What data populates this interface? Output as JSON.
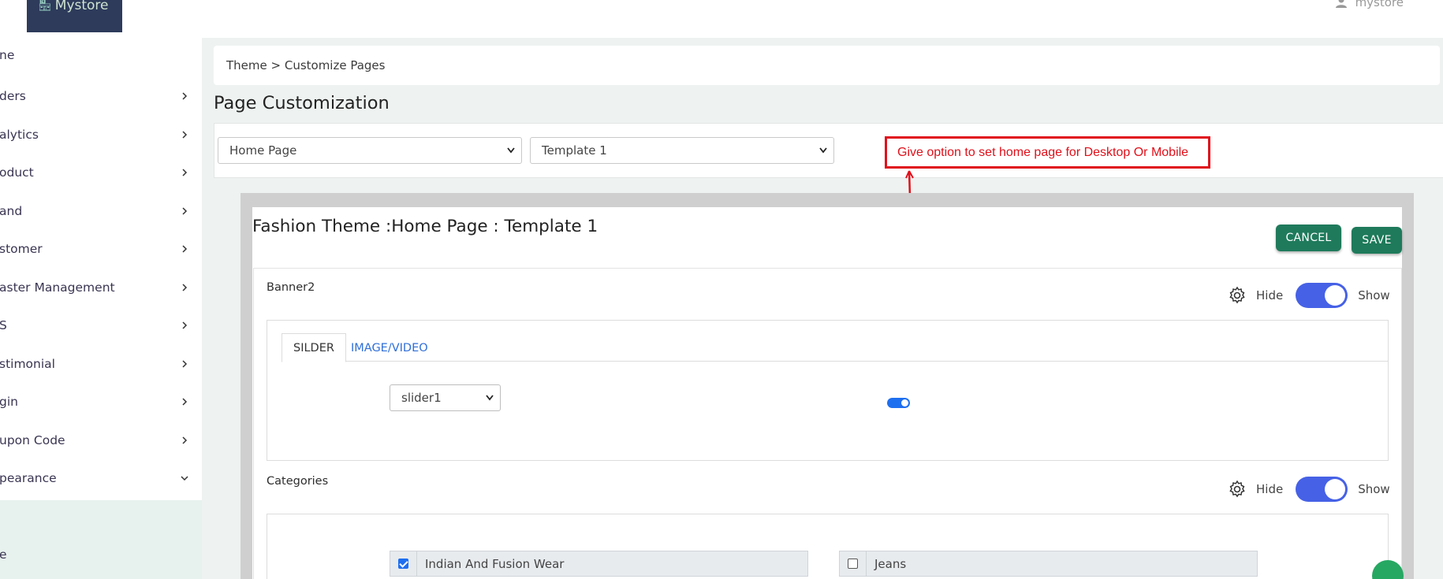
{
  "header": {
    "logo_text": "Mystore",
    "logo_icon": "storefront-icon",
    "user_label": "mystore",
    "user_icon": "user-icon"
  },
  "sidebar": {
    "items": [
      {
        "label": "ne",
        "has_chevron": false
      },
      {
        "label": "ders",
        "has_chevron": true
      },
      {
        "label": "alytics",
        "has_chevron": true
      },
      {
        "label": "oduct",
        "has_chevron": true
      },
      {
        "label": "and",
        "has_chevron": true
      },
      {
        "label": "stomer",
        "has_chevron": true
      },
      {
        "label": "aster Management",
        "has_chevron": true
      },
      {
        "label": "S",
        "has_chevron": true
      },
      {
        "label": "stimonial",
        "has_chevron": true
      },
      {
        "label": "gin",
        "has_chevron": true
      },
      {
        "label": "upon Code",
        "has_chevron": true
      },
      {
        "label": "pearance",
        "has_chevron": true,
        "expanded": true
      },
      {
        "label": "e",
        "has_chevron": false
      }
    ]
  },
  "breadcrumb": "Theme > Customize Pages",
  "page_title": "Page Customization",
  "filters": {
    "page_select": "Home Page",
    "template_select": "Template 1"
  },
  "annotation": {
    "text": "Give option to set home page for Desktop Or Mobile",
    "color": "#e0101a"
  },
  "editor": {
    "title": "Fashion Theme :Home Page : Template 1",
    "cancel_label": "CANCEL",
    "save_label": "SAVE",
    "sections": [
      {
        "name": "Banner2",
        "hide_label": "Hide",
        "show_label": "Show",
        "visible": true,
        "tabs": [
          "SILDER",
          "IMAGE/VIDEO"
        ],
        "active_tab": "SILDER",
        "slider_select": "slider1",
        "slider_enabled": true
      },
      {
        "name": "Categories",
        "hide_label": "Hide",
        "show_label": "Show",
        "visible": true,
        "categories": [
          {
            "label": "Indian And Fusion Wear",
            "checked": true
          },
          {
            "label": "Jeans",
            "checked": false
          }
        ]
      }
    ]
  },
  "colors": {
    "brand_dark": "#2e3b5b",
    "accent_green": "#1f7a5c",
    "toggle_blue": "#4661e6",
    "link_blue": "#2f6fd8",
    "sidebar_active_bg": "#e7f1ee"
  }
}
